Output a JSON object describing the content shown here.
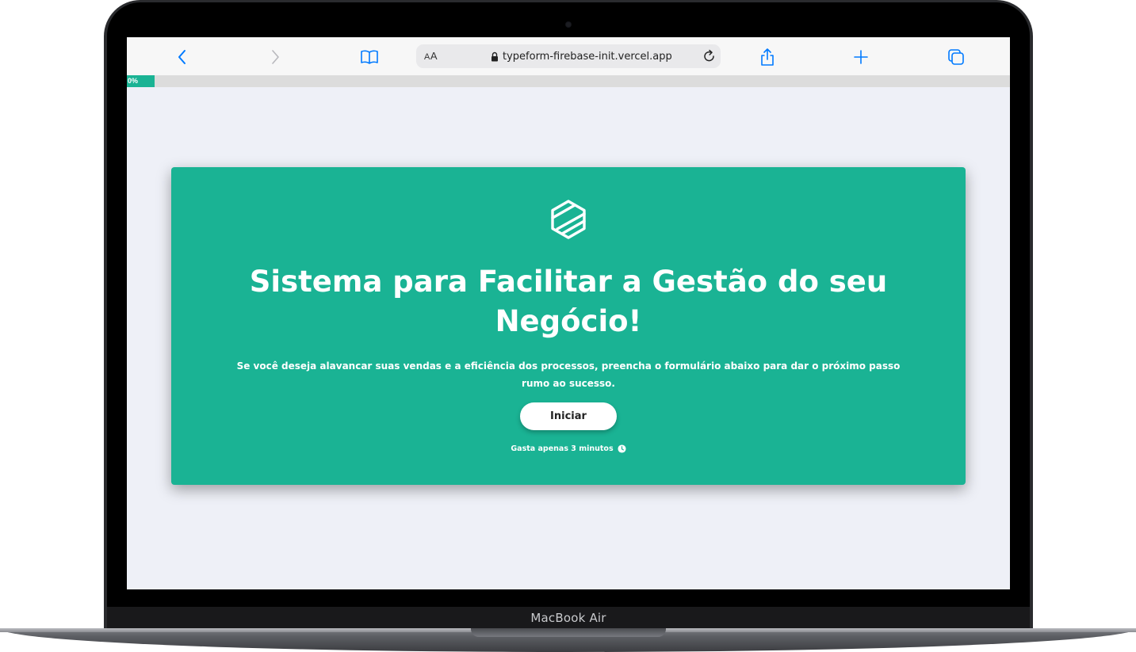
{
  "device": {
    "label": "MacBook Air"
  },
  "browser": {
    "text_size_label_small": "A",
    "text_size_label_big": "A",
    "url": "typeform-firebase-init.vercel.app",
    "icons": {
      "back": "chevron-left-icon",
      "forward": "chevron-right-icon",
      "bookmarks": "book-icon",
      "lock": "lock-icon",
      "reload": "reload-icon",
      "share": "share-icon",
      "new_tab": "plus-icon",
      "tabs": "tabs-icon"
    },
    "accent_color": "#007aff"
  },
  "progress": {
    "label": "0%",
    "value": 0,
    "color": "#1ab394"
  },
  "hero": {
    "title": "Sistema para Facilitar a Gestão do seu Negócio!",
    "subtitle": "Se você deseja alavancar suas vendas e a eficiência dos processos, preencha o formulário abaixo para dar o próximo passo rumo ao sucesso.",
    "start_button": "Iniciar",
    "time_note": "Gasta apenas 3 minutos",
    "background_color": "#1ab394",
    "logo_icon": "hexagon-logo-icon",
    "time_icon": "clock-icon"
  }
}
